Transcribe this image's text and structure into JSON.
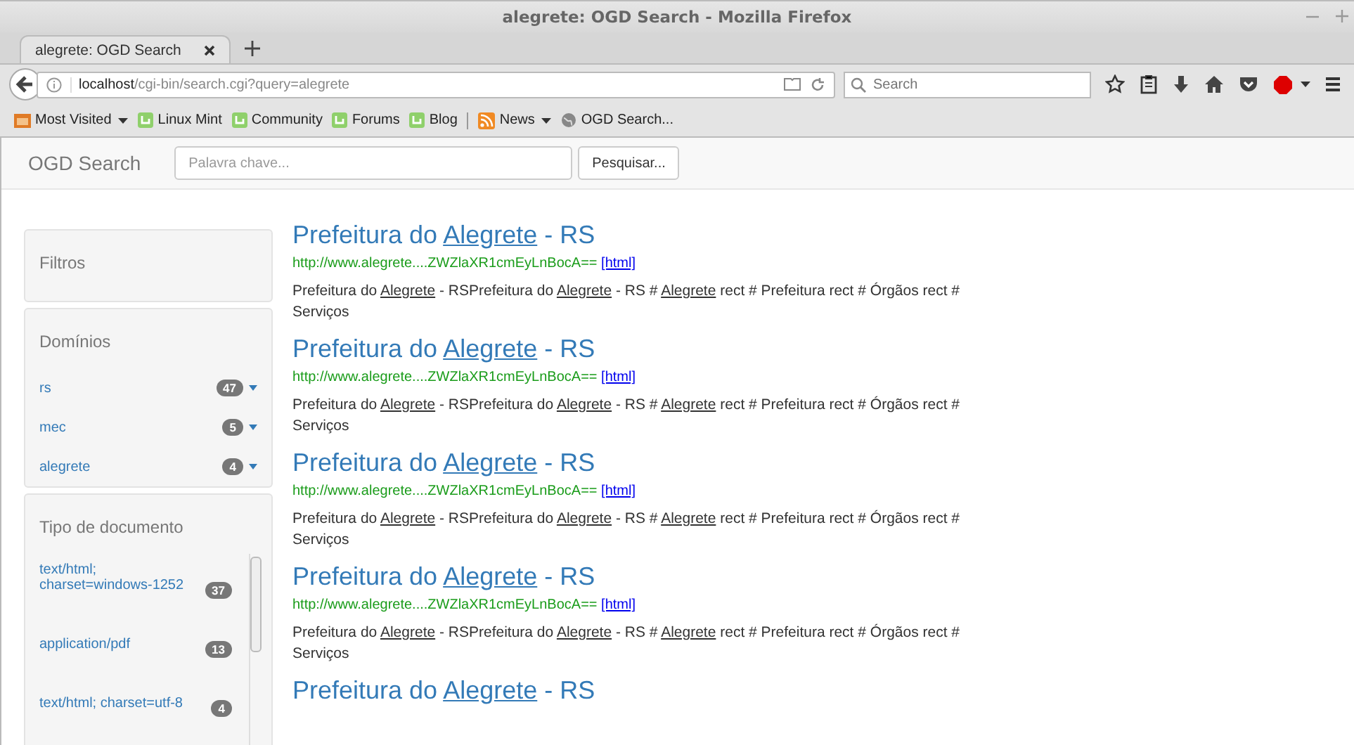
{
  "window": {
    "title": "alegrete: OGD Search - Mozilla Firefox"
  },
  "tabs": [
    {
      "label": "alegrete: OGD Search",
      "selected": true
    }
  ],
  "address_bar": {
    "host": "localhost",
    "path": "/cgi-bin/search.cgi?query=alegrete"
  },
  "browser_search": {
    "placeholder": "Search"
  },
  "bookmarks": [
    {
      "label": "Most Visited",
      "kind": "folder",
      "dropdown": true,
      "separator_before": false
    },
    {
      "label": "Linux Mint",
      "kind": "mint",
      "dropdown": false,
      "separator_before": false
    },
    {
      "label": "Community",
      "kind": "mint",
      "dropdown": false,
      "separator_before": false
    },
    {
      "label": "Forums",
      "kind": "mint",
      "dropdown": false,
      "separator_before": false
    },
    {
      "label": "Blog",
      "kind": "mint",
      "dropdown": false,
      "separator_before": false
    },
    {
      "label": "News",
      "kind": "feed",
      "dropdown": true,
      "separator_before": true
    },
    {
      "label": "OGD Search...",
      "kind": "globe",
      "dropdown": false,
      "separator_before": false
    }
  ],
  "site_header": {
    "brand": "OGD Search",
    "search_placeholder": "Palavra chave...",
    "button": "Pesquisar..."
  },
  "sidebar": [
    {
      "title": "Filtros",
      "kind": "plain"
    },
    {
      "title": "Domínios",
      "kind": "list",
      "items": [
        {
          "label": "rs",
          "count": "47"
        },
        {
          "label": "mec",
          "count": "5"
        },
        {
          "label": "alegrete",
          "count": "4"
        }
      ]
    },
    {
      "title": "Tipo de documento",
      "kind": "scroll",
      "items": [
        {
          "label": "text/html; charset=windows-1252",
          "count": "37"
        },
        {
          "label": "application/pdf",
          "count": "13"
        },
        {
          "label": "text/html; charset=utf-8",
          "count": "4"
        }
      ]
    }
  ],
  "results": [
    {
      "title": [
        {
          "text": "Prefeitura do ",
          "underline": false
        },
        {
          "text": "Alegrete",
          "underline": true
        },
        {
          "text": " - RS",
          "underline": false
        }
      ],
      "url": "http://www.alegrete....ZWZlaXR1cmEyLnBocA==",
      "format": "[html]",
      "snippet": [
        {
          "text": "Prefeitura do ",
          "underline": false
        },
        {
          "text": "Alegrete",
          "underline": true
        },
        {
          "text": " - RSPrefeitura do ",
          "underline": false
        },
        {
          "text": "Alegrete",
          "underline": true
        },
        {
          "text": " - RS # ",
          "underline": false
        },
        {
          "text": "Alegrete",
          "underline": true
        },
        {
          "text": " rect # Prefeitura rect # Órgãos rect # Serviços",
          "underline": false
        }
      ]
    },
    {
      "title": [
        {
          "text": "Prefeitura do ",
          "underline": false
        },
        {
          "text": "Alegrete",
          "underline": true
        },
        {
          "text": " - RS",
          "underline": false
        }
      ],
      "url": "http://www.alegrete....ZWZlaXR1cmEyLnBocA==",
      "format": "[html]",
      "snippet": [
        {
          "text": "Prefeitura do ",
          "underline": false
        },
        {
          "text": "Alegrete",
          "underline": true
        },
        {
          "text": " - RSPrefeitura do ",
          "underline": false
        },
        {
          "text": "Alegrete",
          "underline": true
        },
        {
          "text": " - RS # ",
          "underline": false
        },
        {
          "text": "Alegrete",
          "underline": true
        },
        {
          "text": " rect # Prefeitura rect # Órgãos rect # Serviços",
          "underline": false
        }
      ]
    },
    {
      "title": [
        {
          "text": "Prefeitura do ",
          "underline": false
        },
        {
          "text": "Alegrete",
          "underline": true
        },
        {
          "text": " - RS",
          "underline": false
        }
      ],
      "url": "http://www.alegrete....ZWZlaXR1cmEyLnBocA==",
      "format": "[html]",
      "snippet": [
        {
          "text": "Prefeitura do ",
          "underline": false
        },
        {
          "text": "Alegrete",
          "underline": true
        },
        {
          "text": " - RSPrefeitura do ",
          "underline": false
        },
        {
          "text": "Alegrete",
          "underline": true
        },
        {
          "text": " - RS # ",
          "underline": false
        },
        {
          "text": "Alegrete",
          "underline": true
        },
        {
          "text": " rect # Prefeitura rect # Órgãos rect # Serviços",
          "underline": false
        }
      ]
    },
    {
      "title": [
        {
          "text": "Prefeitura do ",
          "underline": false
        },
        {
          "text": "Alegrete",
          "underline": true
        },
        {
          "text": " - RS",
          "underline": false
        }
      ],
      "url": "http://www.alegrete....ZWZlaXR1cmEyLnBocA==",
      "format": "[html]",
      "snippet": [
        {
          "text": "Prefeitura do ",
          "underline": false
        },
        {
          "text": "Alegrete",
          "underline": true
        },
        {
          "text": " - RSPrefeitura do ",
          "underline": false
        },
        {
          "text": "Alegrete",
          "underline": true
        },
        {
          "text": " - RS # ",
          "underline": false
        },
        {
          "text": "Alegrete",
          "underline": true
        },
        {
          "text": " rect # Prefeitura rect # Órgãos rect # Serviços",
          "underline": false
        }
      ]
    },
    {
      "title": [
        {
          "text": "Prefeitura do ",
          "underline": false
        },
        {
          "text": "Alegrete",
          "underline": true
        },
        {
          "text": " - RS",
          "underline": false
        }
      ]
    }
  ]
}
